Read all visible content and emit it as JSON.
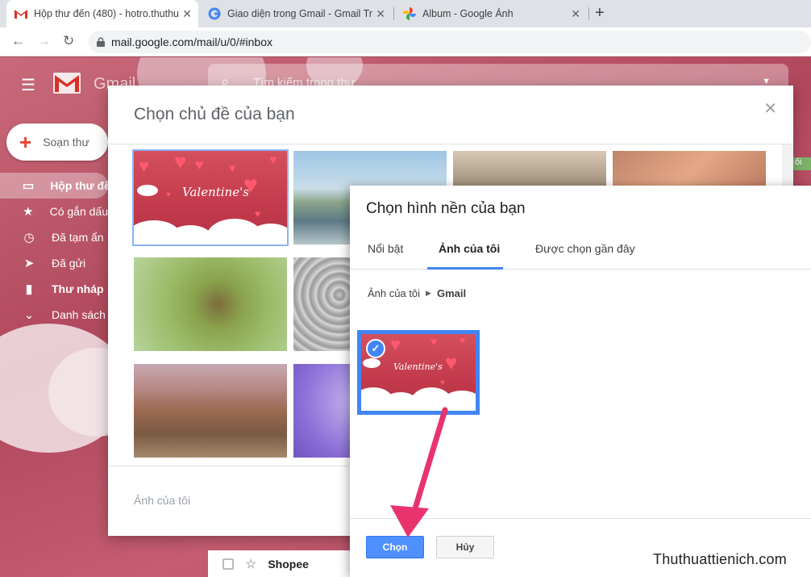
{
  "browser": {
    "tabs": [
      {
        "title": "Hộp thư đến (480) - hotro.thuthu",
        "icon": "gmail-icon"
      },
      {
        "title": "Giao diện trong Gmail - Gmail Tr",
        "icon": "google-icon"
      },
      {
        "title": "Album - Google Ảnh",
        "icon": "google-photos-icon"
      }
    ],
    "url": "mail.google.com/mail/u/0/#inbox"
  },
  "gmail": {
    "logo_text": "Gmail",
    "search_placeholder": "Tìm kiếm trong thư",
    "compose_label": "Soạn thư",
    "nav": [
      {
        "label": "Hộp thư đến",
        "icon": "inbox-icon"
      },
      {
        "label": "Có gắn dấu",
        "icon": "star-icon"
      },
      {
        "label": "Đã tạm ẩn",
        "icon": "clock-icon"
      },
      {
        "label": "Đã gửi",
        "icon": "send-icon"
      },
      {
        "label": "Thư nháp",
        "icon": "draft-icon"
      },
      {
        "label": "Danh sách",
        "icon": "chevron-down-icon"
      }
    ],
    "mail_row": {
      "sender": "Shopee"
    },
    "badge_partial": "ối"
  },
  "theme_dialog": {
    "title": "Chọn chủ đề của bạn",
    "footer_label": "Ảnh của tôi",
    "valentine_text": "Valentine's"
  },
  "bg_dialog": {
    "title": "Chọn hình nền của bạn",
    "tabs": [
      {
        "label": "Nổi bật"
      },
      {
        "label": "Ảnh của tôi",
        "active": true
      },
      {
        "label": "Được chọn gần đây"
      }
    ],
    "breadcrumb": {
      "root": "Ảnh của tôi",
      "current": "Gmail"
    },
    "photo_text": "Valentine's",
    "choose_label": "Chọn",
    "cancel_label": "Hủy"
  },
  "watermark": "Thuthuattienich.com",
  "colors": {
    "accent": "#4285f4",
    "arrow": "#e8336e"
  }
}
